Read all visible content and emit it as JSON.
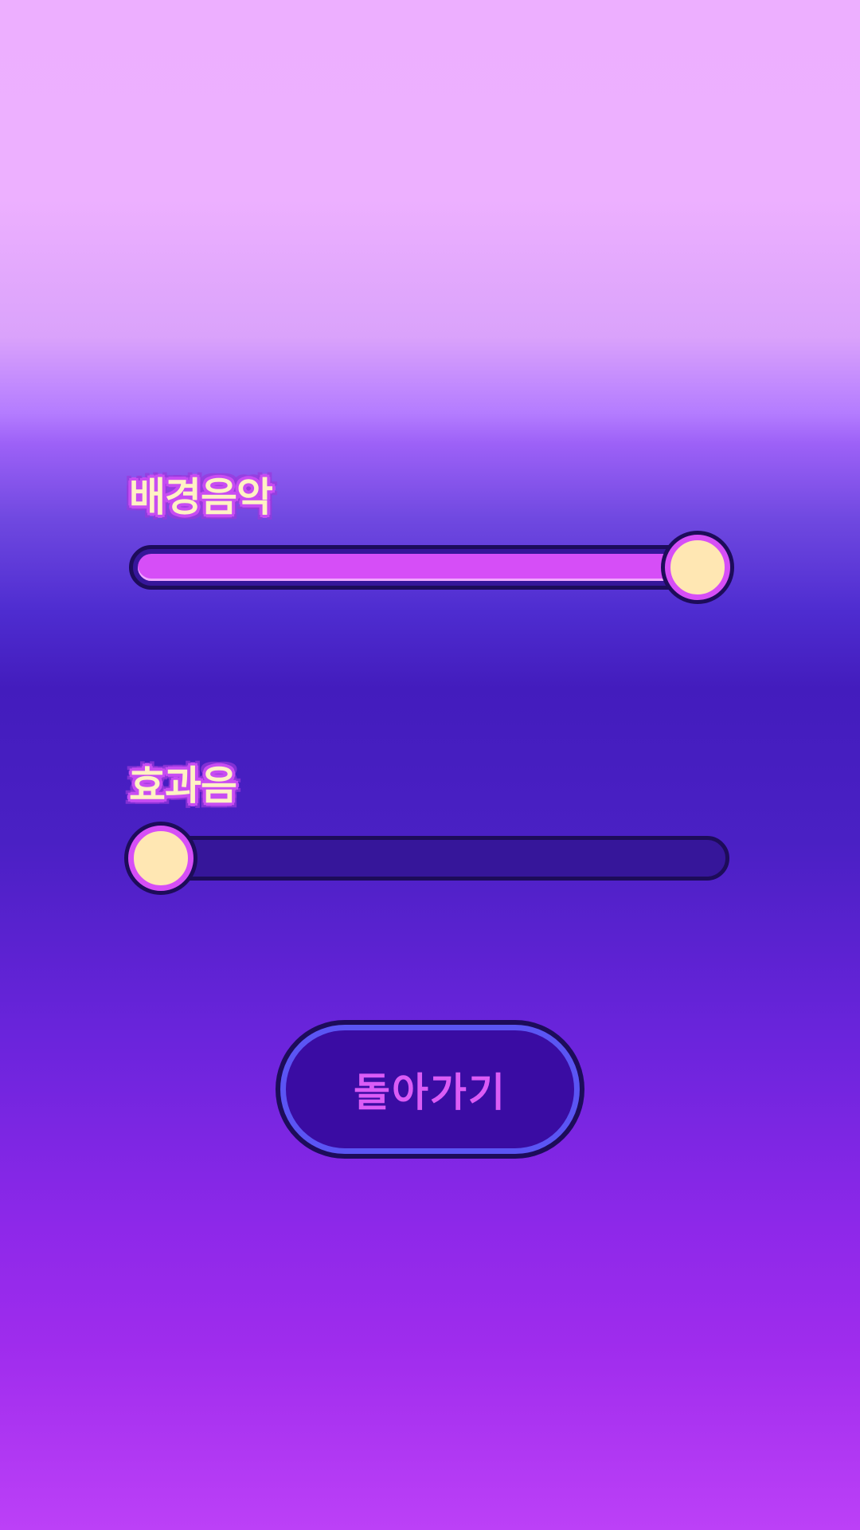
{
  "settings": {
    "bgm": {
      "label": "배경음악",
      "level": 1.0
    },
    "sfx": {
      "label": "효과음",
      "level": 0.0
    }
  },
  "back_button": {
    "label": "돌아가기"
  },
  "colors": {
    "label_text": "#fff2c4",
    "label_outline": "#c84cf2",
    "track": "#36169a",
    "track_border": "#1d0c5a",
    "fill": "#d64ef7",
    "thumb": "#ffe7b3",
    "button_bg": "#3a0ca3",
    "button_border": "#5b55f4",
    "button_text": "#db5cf6"
  }
}
